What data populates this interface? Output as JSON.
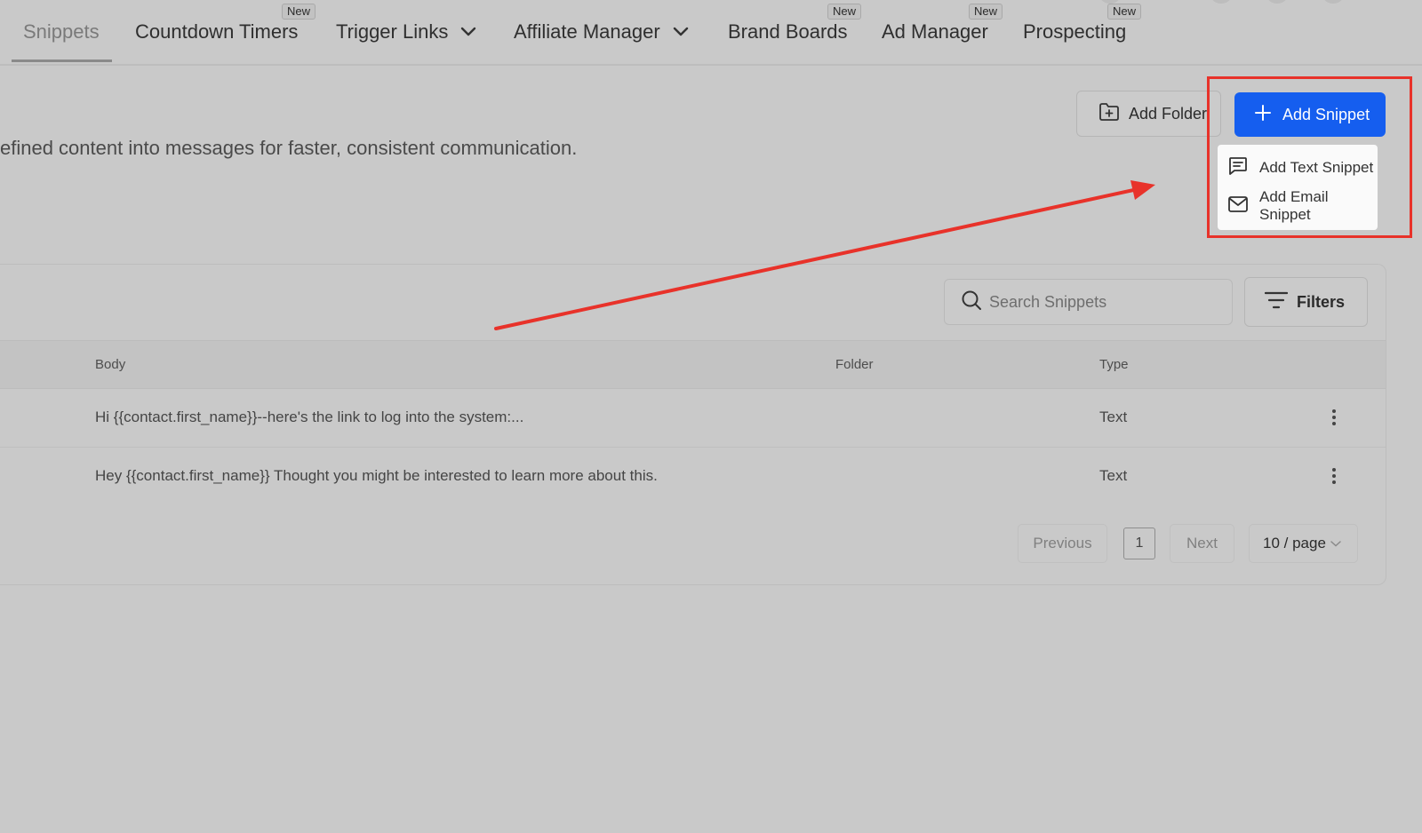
{
  "nav": {
    "items": [
      {
        "label": "Snippets",
        "badge": ""
      },
      {
        "label": "Countdown Timers",
        "badge": "New"
      },
      {
        "label": "Trigger Links",
        "badge": ""
      },
      {
        "label": "Affiliate Manager",
        "badge": ""
      },
      {
        "label": "Brand Boards",
        "badge": "New"
      },
      {
        "label": "Ad Manager",
        "badge": "New"
      },
      {
        "label": "Prospecting",
        "badge": "New"
      }
    ]
  },
  "header": {
    "description": "efined content into messages for faster, consistent communication.",
    "add_folder_label": "Add Folder",
    "add_snippet_label": "Add Snippet"
  },
  "dropdown": {
    "items": [
      {
        "label": "Add Text Snippet",
        "icon": "message-icon"
      },
      {
        "label": "Add Email Snippet",
        "icon": "mail-icon"
      }
    ]
  },
  "toolbar": {
    "search_placeholder": "Search Snippets",
    "filters_label": "Filters"
  },
  "table": {
    "columns": [
      "Body",
      "Folder",
      "Type"
    ],
    "rows": [
      {
        "body": "Hi {{contact.first_name}}--here's the link to log into the system:...",
        "folder": "",
        "type": "Text"
      },
      {
        "body": "Hey {{contact.first_name}} Thought you might be interested to learn more about this.",
        "folder": "",
        "type": "Text"
      }
    ]
  },
  "pagination": {
    "previous_label": "Previous",
    "current_page": "1",
    "next_label": "Next",
    "page_size_label": "10 / page"
  },
  "colors": {
    "primary": "#155eef",
    "annotation": "#e8322a",
    "background": "#c9c9c9"
  }
}
